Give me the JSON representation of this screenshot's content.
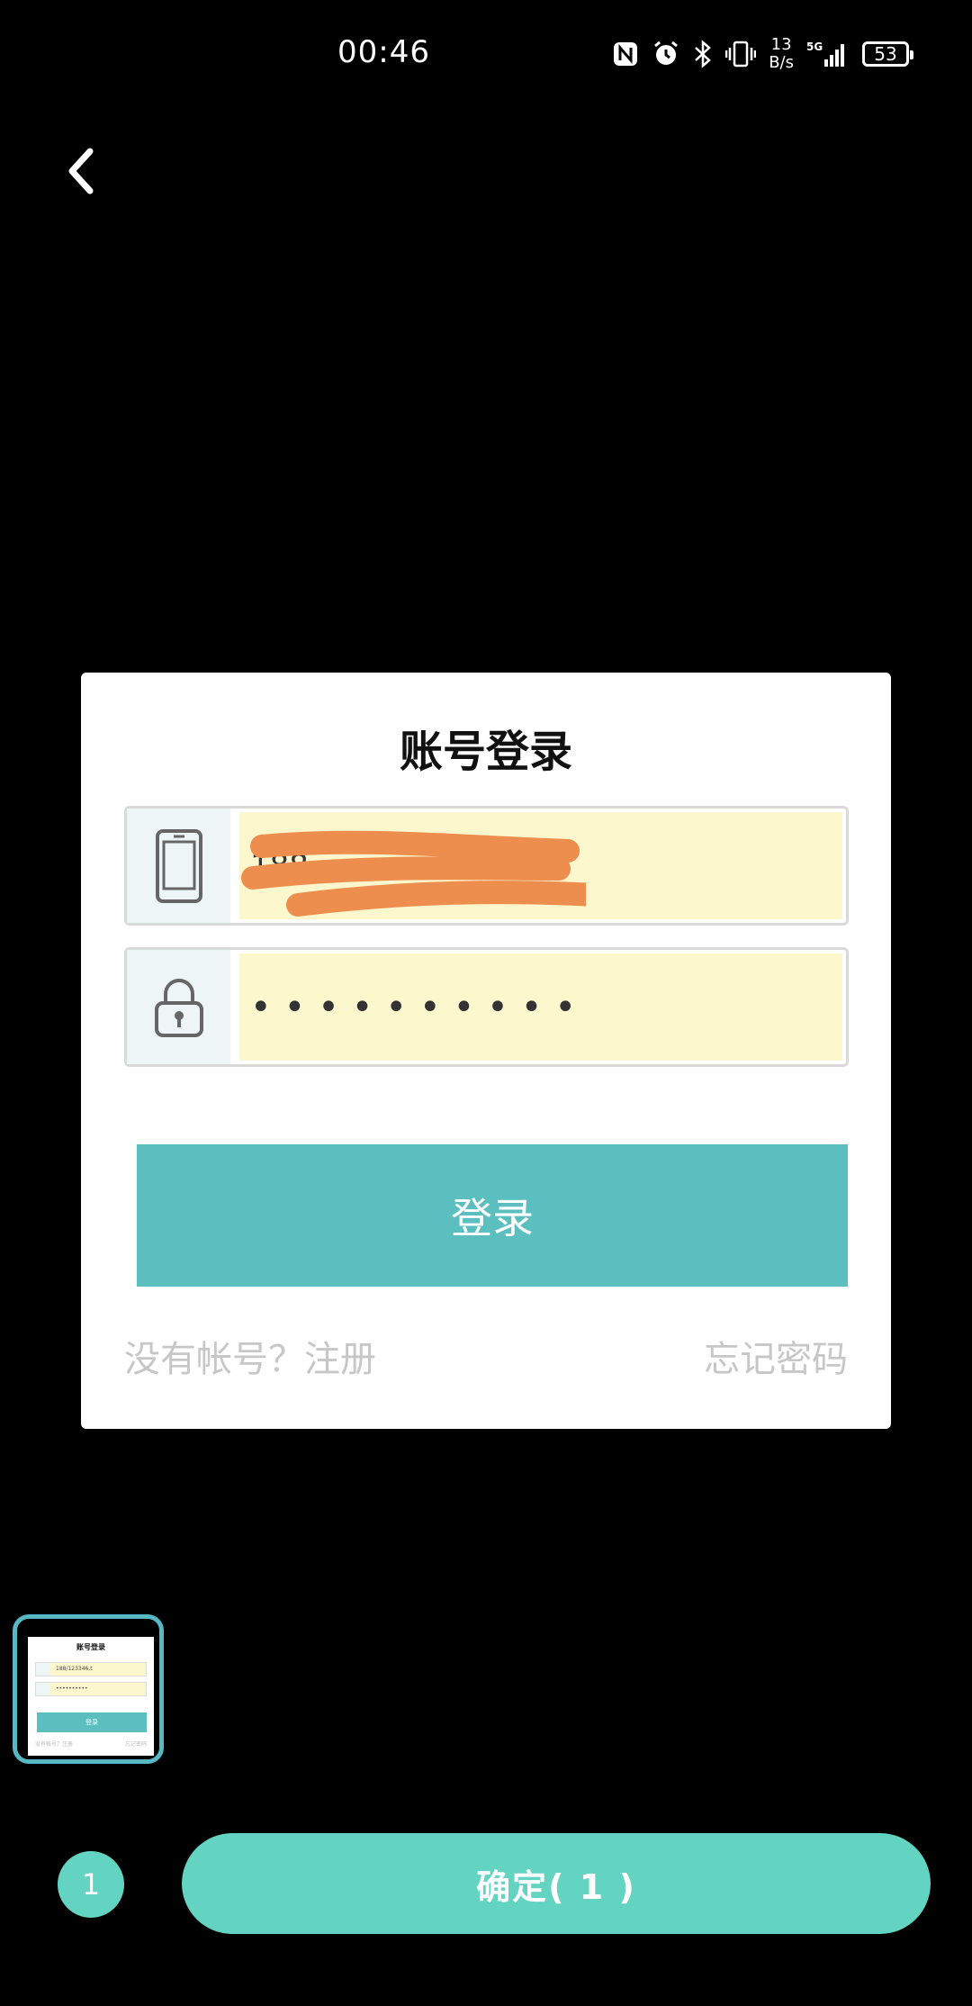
{
  "status_bar": {
    "time": "00:46",
    "net_speed_value": "13",
    "net_speed_unit": "B/s",
    "network": "5G",
    "battery": "53",
    "icons": [
      "nfc-icon",
      "alarm-icon",
      "bluetooth-icon",
      "vibrate-icon",
      "signal-icon",
      "battery-icon"
    ]
  },
  "nav": {
    "back_icon": "chevron-left-icon"
  },
  "preview": {
    "title": "账号登录",
    "phone_field": {
      "icon": "phone-icon",
      "value": "188"
    },
    "password_field": {
      "icon": "lock-icon",
      "value": "••••••••••"
    },
    "login_button": "登录",
    "register_link": "没有帐号？注册",
    "forgot_link": "忘记密码"
  },
  "thumbnail": {
    "title": "账号登录",
    "phone_value": "188/123346.t",
    "password_value": "••••••••••",
    "button": "登录",
    "register": "没有帐号？注册",
    "forgot": "忘记密码"
  },
  "bottom": {
    "selected_count": "1",
    "confirm_label": "确定( 1 )"
  },
  "colors": {
    "accent": "#63d3c2",
    "login_button": "#5bbfc0",
    "input_bg": "#fdf7cd",
    "redaction": "#ee8e4e"
  }
}
